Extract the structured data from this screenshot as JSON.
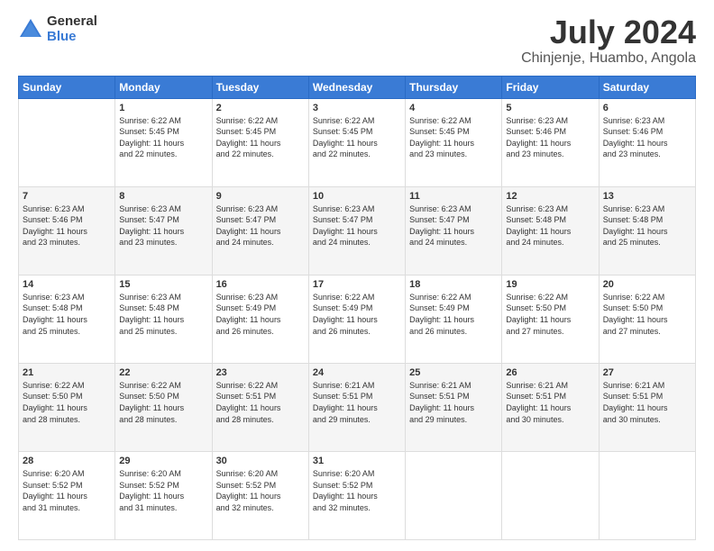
{
  "header": {
    "logo_general": "General",
    "logo_blue": "Blue",
    "title": "July 2024",
    "subtitle": "Chinjenje, Huambo, Angola"
  },
  "calendar": {
    "days": [
      "Sunday",
      "Monday",
      "Tuesday",
      "Wednesday",
      "Thursday",
      "Friday",
      "Saturday"
    ],
    "weeks": [
      [
        {
          "date": "",
          "info": ""
        },
        {
          "date": "1",
          "info": "Sunrise: 6:22 AM\nSunset: 5:45 PM\nDaylight: 11 hours\nand 22 minutes."
        },
        {
          "date": "2",
          "info": "Sunrise: 6:22 AM\nSunset: 5:45 PM\nDaylight: 11 hours\nand 22 minutes."
        },
        {
          "date": "3",
          "info": "Sunrise: 6:22 AM\nSunset: 5:45 PM\nDaylight: 11 hours\nand 22 minutes."
        },
        {
          "date": "4",
          "info": "Sunrise: 6:22 AM\nSunset: 5:45 PM\nDaylight: 11 hours\nand 23 minutes."
        },
        {
          "date": "5",
          "info": "Sunrise: 6:23 AM\nSunset: 5:46 PM\nDaylight: 11 hours\nand 23 minutes."
        },
        {
          "date": "6",
          "info": "Sunrise: 6:23 AM\nSunset: 5:46 PM\nDaylight: 11 hours\nand 23 minutes."
        }
      ],
      [
        {
          "date": "7",
          "info": "Sunrise: 6:23 AM\nSunset: 5:46 PM\nDaylight: 11 hours\nand 23 minutes."
        },
        {
          "date": "8",
          "info": "Sunrise: 6:23 AM\nSunset: 5:47 PM\nDaylight: 11 hours\nand 23 minutes."
        },
        {
          "date": "9",
          "info": "Sunrise: 6:23 AM\nSunset: 5:47 PM\nDaylight: 11 hours\nand 24 minutes."
        },
        {
          "date": "10",
          "info": "Sunrise: 6:23 AM\nSunset: 5:47 PM\nDaylight: 11 hours\nand 24 minutes."
        },
        {
          "date": "11",
          "info": "Sunrise: 6:23 AM\nSunset: 5:47 PM\nDaylight: 11 hours\nand 24 minutes."
        },
        {
          "date": "12",
          "info": "Sunrise: 6:23 AM\nSunset: 5:48 PM\nDaylight: 11 hours\nand 24 minutes."
        },
        {
          "date": "13",
          "info": "Sunrise: 6:23 AM\nSunset: 5:48 PM\nDaylight: 11 hours\nand 25 minutes."
        }
      ],
      [
        {
          "date": "14",
          "info": "Sunrise: 6:23 AM\nSunset: 5:48 PM\nDaylight: 11 hours\nand 25 minutes."
        },
        {
          "date": "15",
          "info": "Sunrise: 6:23 AM\nSunset: 5:48 PM\nDaylight: 11 hours\nand 25 minutes."
        },
        {
          "date": "16",
          "info": "Sunrise: 6:23 AM\nSunset: 5:49 PM\nDaylight: 11 hours\nand 26 minutes."
        },
        {
          "date": "17",
          "info": "Sunrise: 6:22 AM\nSunset: 5:49 PM\nDaylight: 11 hours\nand 26 minutes."
        },
        {
          "date": "18",
          "info": "Sunrise: 6:22 AM\nSunset: 5:49 PM\nDaylight: 11 hours\nand 26 minutes."
        },
        {
          "date": "19",
          "info": "Sunrise: 6:22 AM\nSunset: 5:50 PM\nDaylight: 11 hours\nand 27 minutes."
        },
        {
          "date": "20",
          "info": "Sunrise: 6:22 AM\nSunset: 5:50 PM\nDaylight: 11 hours\nand 27 minutes."
        }
      ],
      [
        {
          "date": "21",
          "info": "Sunrise: 6:22 AM\nSunset: 5:50 PM\nDaylight: 11 hours\nand 28 minutes."
        },
        {
          "date": "22",
          "info": "Sunrise: 6:22 AM\nSunset: 5:50 PM\nDaylight: 11 hours\nand 28 minutes."
        },
        {
          "date": "23",
          "info": "Sunrise: 6:22 AM\nSunset: 5:51 PM\nDaylight: 11 hours\nand 28 minutes."
        },
        {
          "date": "24",
          "info": "Sunrise: 6:21 AM\nSunset: 5:51 PM\nDaylight: 11 hours\nand 29 minutes."
        },
        {
          "date": "25",
          "info": "Sunrise: 6:21 AM\nSunset: 5:51 PM\nDaylight: 11 hours\nand 29 minutes."
        },
        {
          "date": "26",
          "info": "Sunrise: 6:21 AM\nSunset: 5:51 PM\nDaylight: 11 hours\nand 30 minutes."
        },
        {
          "date": "27",
          "info": "Sunrise: 6:21 AM\nSunset: 5:51 PM\nDaylight: 11 hours\nand 30 minutes."
        }
      ],
      [
        {
          "date": "28",
          "info": "Sunrise: 6:20 AM\nSunset: 5:52 PM\nDaylight: 11 hours\nand 31 minutes."
        },
        {
          "date": "29",
          "info": "Sunrise: 6:20 AM\nSunset: 5:52 PM\nDaylight: 11 hours\nand 31 minutes."
        },
        {
          "date": "30",
          "info": "Sunrise: 6:20 AM\nSunset: 5:52 PM\nDaylight: 11 hours\nand 32 minutes."
        },
        {
          "date": "31",
          "info": "Sunrise: 6:20 AM\nSunset: 5:52 PM\nDaylight: 11 hours\nand 32 minutes."
        },
        {
          "date": "",
          "info": ""
        },
        {
          "date": "",
          "info": ""
        },
        {
          "date": "",
          "info": ""
        }
      ]
    ]
  }
}
